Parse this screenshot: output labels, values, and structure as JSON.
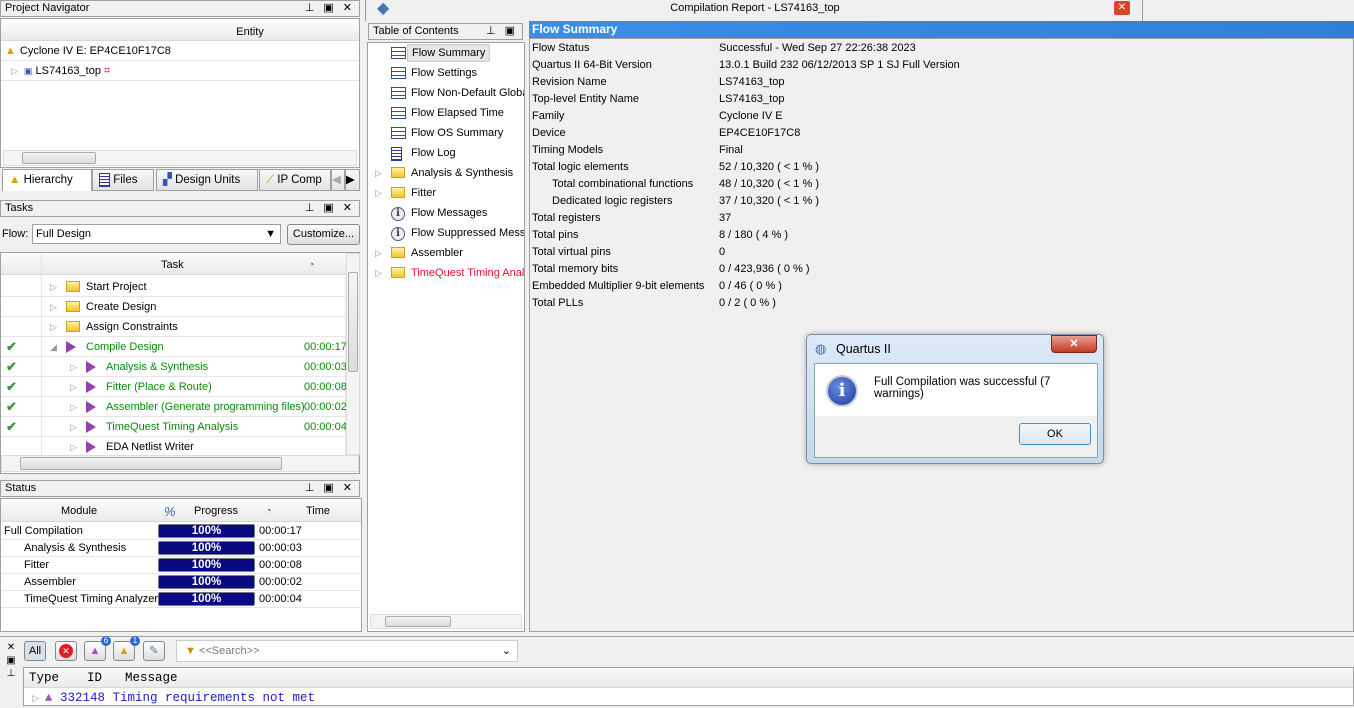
{
  "project_navigator": {
    "title": "Project Navigator",
    "column": "Entity",
    "device": "Cyclone IV E: EP4CE10F17C8",
    "top_entity": "LS74163_top",
    "tabs": [
      "Hierarchy",
      "Files",
      "Design Units",
      "IP Comp"
    ]
  },
  "tasks": {
    "title": "Tasks",
    "flow_label": "Flow:",
    "flow_value": "Full Design",
    "customize": "Customize...",
    "column": "Task",
    "rows": [
      {
        "label": "Start Project",
        "time": "",
        "done": false
      },
      {
        "label": "Create Design",
        "time": "",
        "done": false
      },
      {
        "label": "Assign Constraints",
        "time": "",
        "done": false
      },
      {
        "label": "Compile Design",
        "time": "00:00:17",
        "done": true
      },
      {
        "label": "Analysis & Synthesis",
        "time": "00:00:03",
        "done": true
      },
      {
        "label": "Fitter (Place & Route)",
        "time": "00:00:08",
        "done": true
      },
      {
        "label": "Assembler (Generate programming files)",
        "time": "00:00:02",
        "done": true
      },
      {
        "label": "TimeQuest Timing Analysis",
        "time": "00:00:04",
        "done": true
      },
      {
        "label": "EDA Netlist Writer",
        "time": "",
        "done": false
      }
    ]
  },
  "status": {
    "title": "Status",
    "columns": [
      "Module",
      "%",
      "Progress",
      "Time"
    ],
    "rows": [
      {
        "module": "Full Compilation",
        "progress": "100%",
        "time": "00:00:17"
      },
      {
        "module": "Analysis & Synthesis",
        "progress": "100%",
        "time": "00:00:03"
      },
      {
        "module": "Fitter",
        "progress": "100%",
        "time": "00:00:08"
      },
      {
        "module": "Assembler",
        "progress": "100%",
        "time": "00:00:02"
      },
      {
        "module": "TimeQuest Timing Analyzer",
        "progress": "100%",
        "time": "00:00:04"
      }
    ]
  },
  "report": {
    "title": "Compilation Report - LS74163_top",
    "close": "✕",
    "toc_title": "Table of Contents",
    "toc": [
      "Flow Summary",
      "Flow Settings",
      "Flow Non-Default Global Settings",
      "Flow Elapsed Time",
      "Flow OS Summary",
      "Flow Log",
      "Analysis & Synthesis",
      "Fitter",
      "Flow Messages",
      "Flow Suppressed Messages",
      "Assembler",
      "TimeQuest Timing Analyzer"
    ],
    "summary_title": "Flow Summary",
    "summary": [
      [
        "Flow Status",
        "Successful - Wed Sep 27 22:26:38 2023"
      ],
      [
        "Quartus II 64-Bit Version",
        "13.0.1 Build 232 06/12/2013 SP 1 SJ Full Version"
      ],
      [
        "Revision Name",
        "LS74163_top"
      ],
      [
        "Top-level Entity Name",
        "LS74163_top"
      ],
      [
        "Family",
        "Cyclone IV E"
      ],
      [
        "Device",
        "EP4CE10F17C8"
      ],
      [
        "Timing Models",
        "Final"
      ],
      [
        "Total logic elements",
        "52 / 10,320 ( < 1 % )"
      ],
      [
        "Total combinational functions",
        "48 / 10,320 ( < 1 % )"
      ],
      [
        "Dedicated logic registers",
        "37 / 10,320 ( < 1 % )"
      ],
      [
        "Total registers",
        "37"
      ],
      [
        "Total pins",
        "8 / 180 ( 4 % )"
      ],
      [
        "Total virtual pins",
        "0"
      ],
      [
        "Total memory bits",
        "0 / 423,936 ( 0 % )"
      ],
      [
        "Embedded Multiplier 9-bit elements",
        "0 / 46 ( 0 % )"
      ],
      [
        "Total PLLs",
        "0 / 2 ( 0 % )"
      ]
    ]
  },
  "dialog": {
    "title": "Quartus II",
    "message": "Full Compilation was successful (7 warnings)",
    "ok": "OK"
  },
  "messages": {
    "all": "All",
    "critical_count": "6",
    "warning_count": "1",
    "search_placeholder": "<<Search>>",
    "columns": [
      "Type",
      "ID",
      "Message"
    ],
    "rows": [
      {
        "id": "332148",
        "message": "Timing requirements not met"
      }
    ]
  }
}
